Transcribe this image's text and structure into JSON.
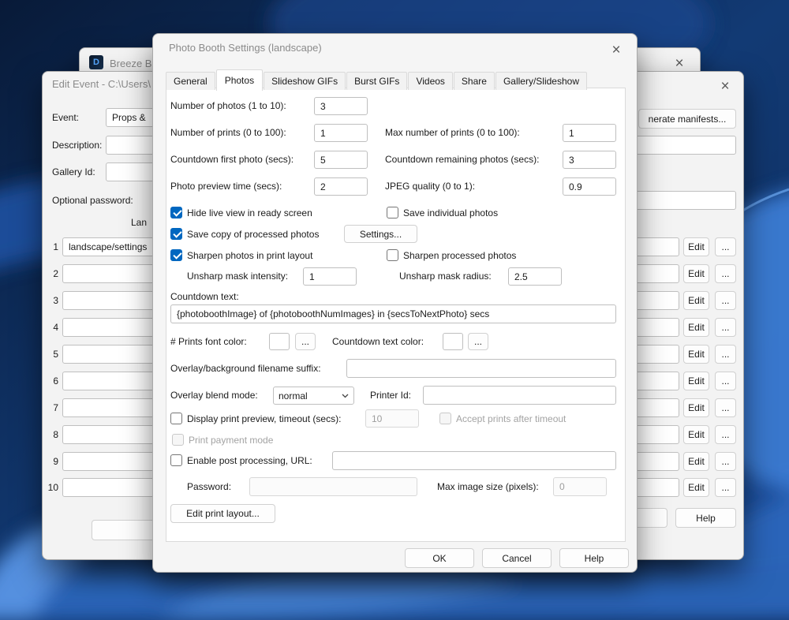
{
  "colors": {
    "accent": "#0067c0",
    "title-text": "#8b8b8b"
  },
  "icons": {
    "close": "×",
    "app_glyph": "D"
  },
  "breeze_window": {
    "title": "Breeze Bo"
  },
  "edit_event": {
    "title": "Edit Event - C:\\Users\\",
    "event_label": "Event:",
    "event_value": "Props &",
    "description_label": "Description:",
    "description_value": "",
    "gallery_label": "Gallery Id:",
    "gallery_value": "",
    "optional_password_label": "Optional password:",
    "optional_password_value": "",
    "generate_manifests_label": "nerate manifests...",
    "column_header_partial": "Lan",
    "edit_label": "Edit",
    "more_label": "...",
    "help_label": "Help",
    "rows": [
      {
        "num": "1",
        "value": "landscape/settings"
      },
      {
        "num": "2",
        "value": ""
      },
      {
        "num": "3",
        "value": ""
      },
      {
        "num": "4",
        "value": ""
      },
      {
        "num": "5",
        "value": ""
      },
      {
        "num": "6",
        "value": ""
      },
      {
        "num": "7",
        "value": ""
      },
      {
        "num": "8",
        "value": ""
      },
      {
        "num": "9",
        "value": ""
      },
      {
        "num": "10",
        "value": ""
      }
    ]
  },
  "settings": {
    "title": "Photo Booth Settings (landscape)",
    "tabs": [
      "General",
      "Photos",
      "Slideshow GIFs",
      "Burst GIFs",
      "Videos",
      "Share",
      "Gallery/Slideshow"
    ],
    "selected_tab": "Photos",
    "photos": {
      "num_photos_label": "Number of photos (1 to 10):",
      "num_photos": "3",
      "num_prints_label": "Number of prints (0 to 100):",
      "num_prints": "1",
      "max_prints_label": "Max number of prints (0 to 100):",
      "max_prints": "1",
      "countdown_first_label": "Countdown first photo (secs):",
      "countdown_first": "5",
      "countdown_remaining_label": "Countdown remaining photos (secs):",
      "countdown_remaining": "3",
      "preview_time_label": "Photo preview time (secs):",
      "preview_time": "2",
      "jpeg_quality_label": "JPEG quality (0 to 1):",
      "jpeg_quality": "0.9",
      "hide_live_view_label": "Hide live view in ready screen",
      "save_individual_label": "Save individual photos",
      "save_copy_label": "Save copy of processed photos",
      "settings_button_label": "Settings...",
      "sharpen_print_label": "Sharpen photos in print layout",
      "sharpen_processed_label": "Sharpen processed photos",
      "unsharp_intensity_label": "Unsharp mask intensity:",
      "unsharp_intensity": "1",
      "unsharp_radius_label": "Unsharp mask radius:",
      "unsharp_radius": "2.5",
      "countdown_text_label": "Countdown text:",
      "countdown_text_value": "{photoboothImage} of {photoboothNumImages} in {secsToNextPhoto} secs",
      "prints_font_color_label": "# Prints font color:",
      "countdown_color_label": "Countdown text color:",
      "picker_more_label": "...",
      "overlay_suffix_label": "Overlay/background filename suffix:",
      "overlay_suffix_value": "",
      "overlay_blend_label": "Overlay blend mode:",
      "overlay_blend_value": "normal",
      "printer_id_label": "Printer Id:",
      "printer_id_value": "",
      "print_preview_label": "Display print preview, timeout (secs):",
      "print_preview_timeout": "10",
      "accept_prints_label": "Accept prints after timeout",
      "print_payment_label": "Print payment mode",
      "post_processing_label": "Enable post processing, URL:",
      "post_processing_url": "",
      "password_label": "Password:",
      "password_value": "",
      "max_image_size_label": "Max image size (pixels):",
      "max_image_size": "0",
      "edit_print_layout_label": "Edit print layout..."
    },
    "ok_label": "OK",
    "cancel_label": "Cancel",
    "help_label": "Help"
  }
}
